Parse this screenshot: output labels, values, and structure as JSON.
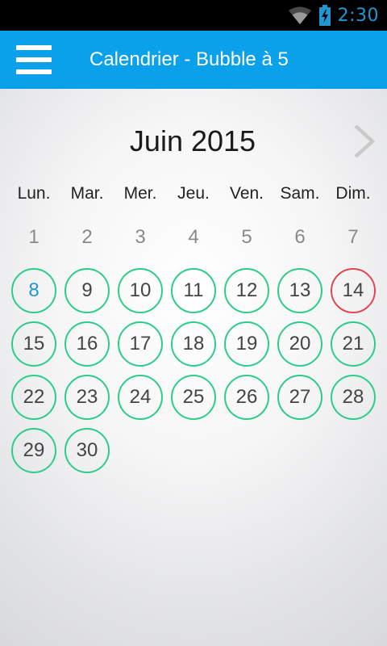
{
  "status_bar": {
    "time": "2:30",
    "icons": [
      "wifi-icon",
      "battery-charging-icon"
    ],
    "clock_color": "#2196d3"
  },
  "app_bar": {
    "title": "Calendrier - Bubble à 5",
    "background": "#0aa0ea",
    "menu_icon": "hamburger-menu-icon"
  },
  "calendar": {
    "month_label": "Juin 2015",
    "next_icon": "chevron-right-icon",
    "weekdays": [
      "Lun.",
      "Mar.",
      "Mer.",
      "Jeu.",
      "Ven.",
      "Sam.",
      "Dim."
    ],
    "weeks": [
      [
        {
          "label": "1",
          "style": "plain"
        },
        {
          "label": "2",
          "style": "plain"
        },
        {
          "label": "3",
          "style": "plain"
        },
        {
          "label": "4",
          "style": "plain"
        },
        {
          "label": "5",
          "style": "plain"
        },
        {
          "label": "6",
          "style": "plain"
        },
        {
          "label": "7",
          "style": "plain"
        }
      ],
      [
        {
          "label": "8",
          "style": "today"
        },
        {
          "label": "9",
          "style": "bubble"
        },
        {
          "label": "10",
          "style": "bubble"
        },
        {
          "label": "11",
          "style": "bubble"
        },
        {
          "label": "12",
          "style": "bubble"
        },
        {
          "label": "13",
          "style": "bubble"
        },
        {
          "label": "14",
          "style": "sunday"
        }
      ],
      [
        {
          "label": "15",
          "style": "bubble"
        },
        {
          "label": "16",
          "style": "bubble"
        },
        {
          "label": "17",
          "style": "bubble"
        },
        {
          "label": "18",
          "style": "bubble"
        },
        {
          "label": "19",
          "style": "bubble"
        },
        {
          "label": "20",
          "style": "bubble"
        },
        {
          "label": "21",
          "style": "bubble"
        }
      ],
      [
        {
          "label": "22",
          "style": "bubble"
        },
        {
          "label": "23",
          "style": "bubble"
        },
        {
          "label": "24",
          "style": "bubble"
        },
        {
          "label": "25",
          "style": "bubble"
        },
        {
          "label": "26",
          "style": "bubble"
        },
        {
          "label": "27",
          "style": "bubble"
        },
        {
          "label": "28",
          "style": "bubble"
        }
      ],
      [
        {
          "label": "29",
          "style": "bubble"
        },
        {
          "label": "30",
          "style": "bubble"
        }
      ]
    ],
    "colors": {
      "bubble_border": "#2ecc8a",
      "sunday_border": "#e0464f",
      "today_text": "#2196d3"
    }
  }
}
